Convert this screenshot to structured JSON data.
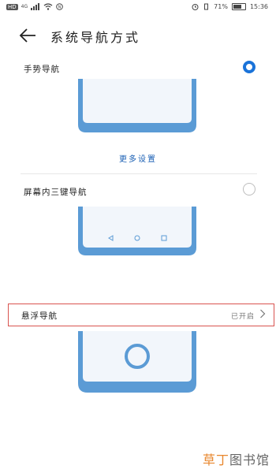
{
  "status_bar": {
    "left_icons": [
      "HD",
      "4G"
    ],
    "battery_percent": "71%",
    "battery_level": 0.71,
    "time": "15:36"
  },
  "header": {
    "title": "系统导航方式"
  },
  "options": {
    "gesture": {
      "label": "手势导航",
      "selected": true
    },
    "more_settings": "更多设置",
    "three_key": {
      "label": "屏幕内三键导航",
      "selected": false
    },
    "floating": {
      "label": "悬浮导航",
      "status": "已开启"
    }
  },
  "colors": {
    "accent": "#1a73d9",
    "phone_frame": "#5b9bd5",
    "highlight_border": "#d9534f"
  },
  "watermark": {
    "brand": "草丁",
    "rest": "图书馆"
  }
}
